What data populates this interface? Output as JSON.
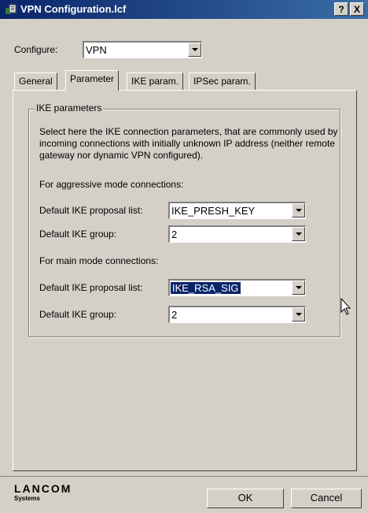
{
  "window": {
    "title": "VPN Configuration.lcf",
    "help_button": "?",
    "close_button": "X"
  },
  "configure": {
    "label": "Configure:",
    "value": "VPN"
  },
  "tabs": [
    {
      "label": "General",
      "active": false
    },
    {
      "label": "Parameter",
      "active": true
    },
    {
      "label": "IKE param.",
      "active": false
    },
    {
      "label": "IPSec param.",
      "active": false
    }
  ],
  "ike_group": {
    "legend": "IKE parameters",
    "description": "Select here the IKE connection parameters, that are commonly used by incoming connections with initially unknown IP address (neither remote gateway nor dynamic VPN configured).",
    "aggressive": {
      "heading": "For aggressive mode connections:",
      "proposal_label": "Default IKE proposal list:",
      "proposal_value": "IKE_PRESH_KEY",
      "group_label": "Default IKE group:",
      "group_value": "2"
    },
    "main": {
      "heading": "For main mode connections:",
      "proposal_label": "Default IKE proposal list:",
      "proposal_value": "IKE_RSA_SIG",
      "group_label": "Default IKE group:",
      "group_value": "2"
    }
  },
  "footer": {
    "logo_name": "LANCOM",
    "logo_sub": "Systems",
    "ok_label": "OK",
    "cancel_label": "Cancel"
  },
  "colors": {
    "titlebar_start": "#0a246a",
    "titlebar_end": "#3a6ea5",
    "face": "#d4d0c8",
    "selection": "#0a246a"
  }
}
